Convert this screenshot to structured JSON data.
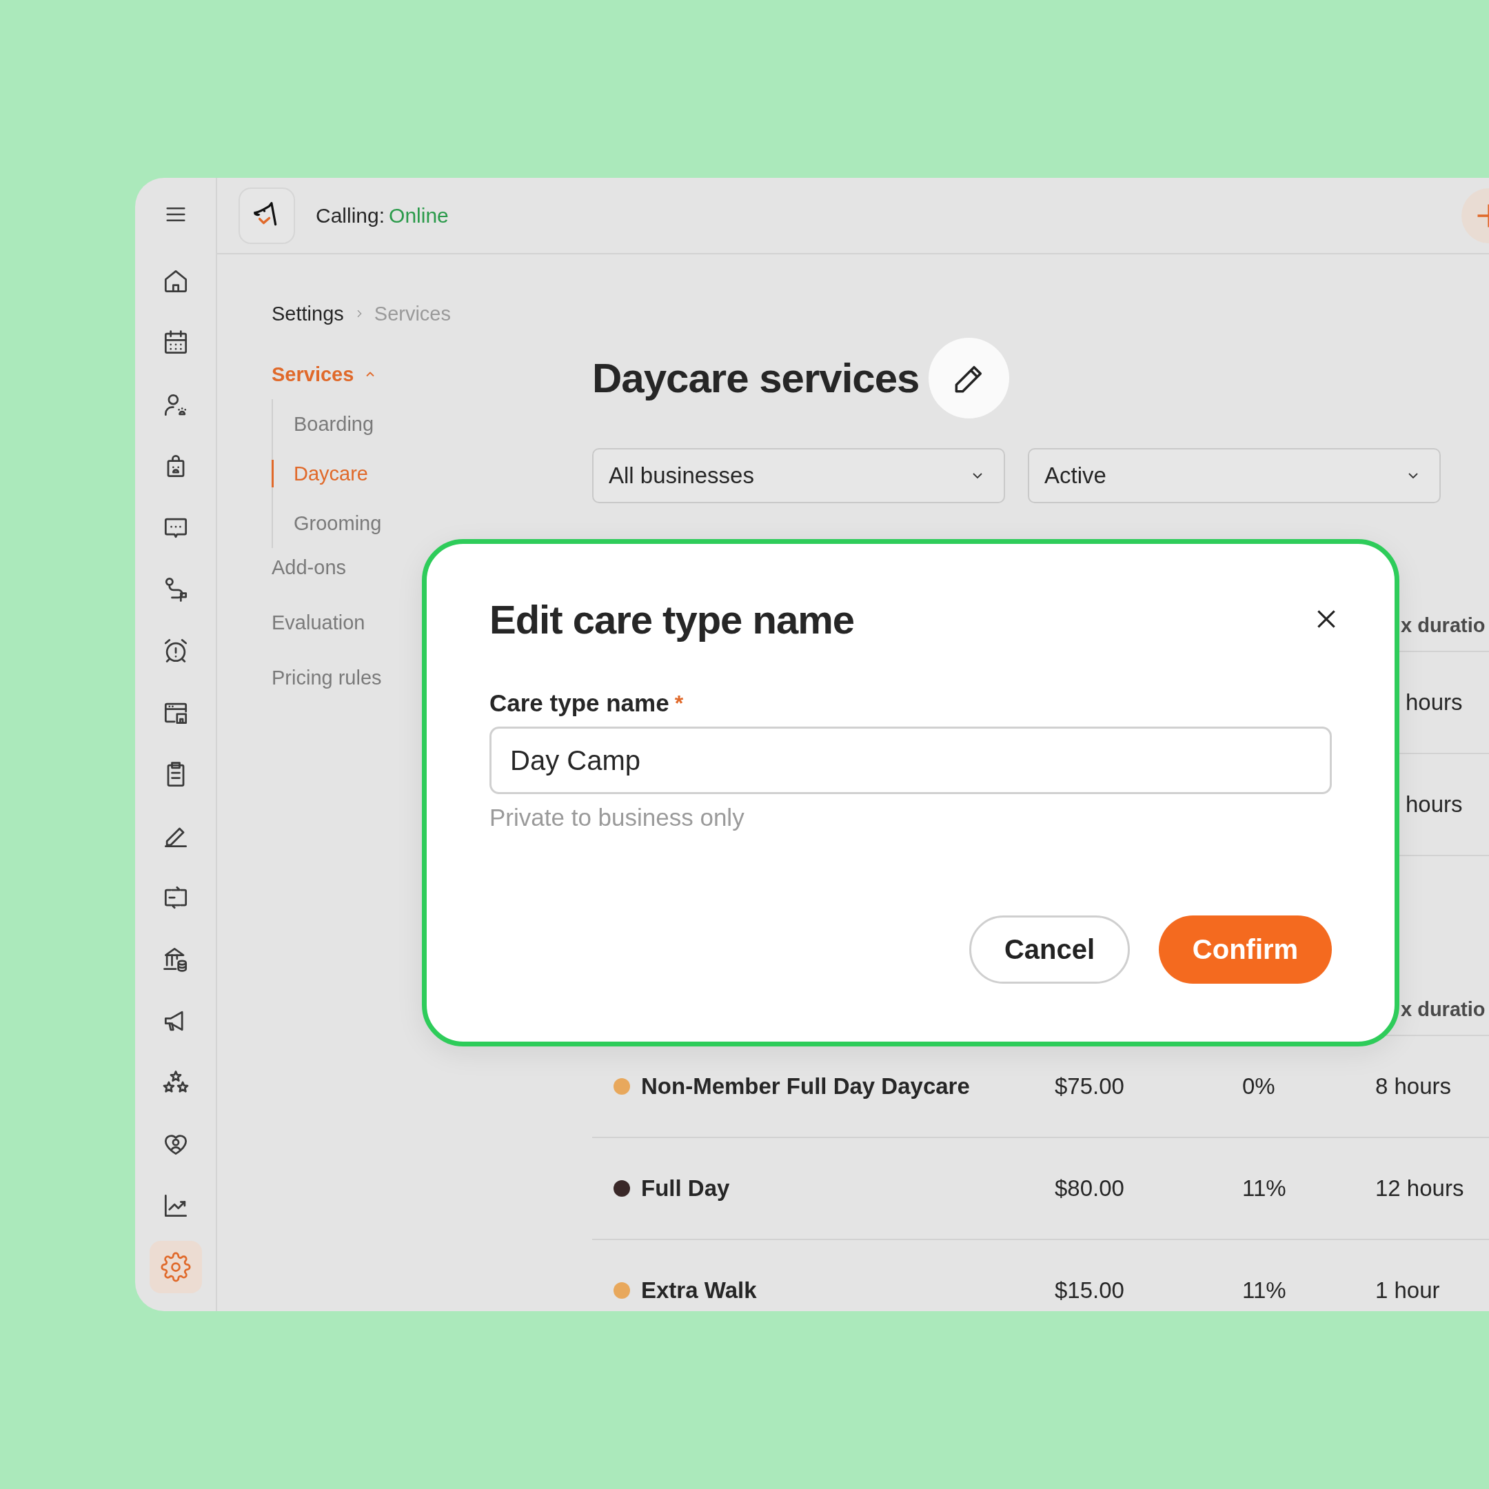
{
  "sidebar": {
    "items": [
      {
        "selected": false
      },
      {
        "selected": false
      },
      {
        "selected": false
      },
      {
        "selected": false
      },
      {
        "selected": false
      },
      {
        "selected": false
      },
      {
        "selected": false
      },
      {
        "selected": false
      },
      {
        "selected": false
      },
      {
        "selected": false
      },
      {
        "selected": false
      },
      {
        "selected": false
      },
      {
        "selected": false
      },
      {
        "selected": false
      },
      {
        "selected": false
      },
      {
        "selected": false
      },
      {
        "selected": true
      }
    ]
  },
  "topbar": {
    "calling_label": "Calling:",
    "calling_status": "Online"
  },
  "breadcrumb": [
    "Settings",
    "Services"
  ],
  "subnav": {
    "items": [
      {
        "label": "Services",
        "selected": true,
        "expanded": true,
        "children": [
          {
            "label": "Boarding",
            "selected": false
          },
          {
            "label": "Daycare",
            "selected": true
          },
          {
            "label": "Grooming",
            "selected": false
          }
        ]
      },
      {
        "label": "Add-ons",
        "selected": false
      },
      {
        "label": "Evaluation",
        "selected": false
      },
      {
        "label": "Pricing rules",
        "selected": false
      }
    ]
  },
  "page": {
    "title": "Daycare services"
  },
  "filters": [
    {
      "value": "All businesses"
    },
    {
      "value": "Active"
    }
  ],
  "table_sections": [
    {
      "header": "x duratio",
      "rows": [
        {
          "duration": "hours"
        },
        {
          "duration": "hours"
        }
      ]
    },
    {
      "header": "x duratio",
      "rows": [
        {
          "name": "Non-Member Full Day Daycare",
          "color": "#e8a85c",
          "price": "$75.00",
          "tax": "0%",
          "duration": "8 hours"
        },
        {
          "name": "Full Day",
          "color": "#3a2828",
          "price": "$80.00",
          "tax": "11%",
          "duration": "12 hours"
        },
        {
          "name": "Extra Walk",
          "color": "#e8a85c",
          "price": "$15.00",
          "tax": "11%",
          "duration": "1 hour"
        }
      ]
    }
  ],
  "modal": {
    "title": "Edit care type name",
    "field_label": "Care type name",
    "required_mark": "*",
    "value": "Day Camp",
    "hint": "Private to business only",
    "buttons": [
      {
        "label": "Cancel",
        "kind": "secondary"
      },
      {
        "label": "Confirm",
        "kind": "primary"
      }
    ]
  }
}
